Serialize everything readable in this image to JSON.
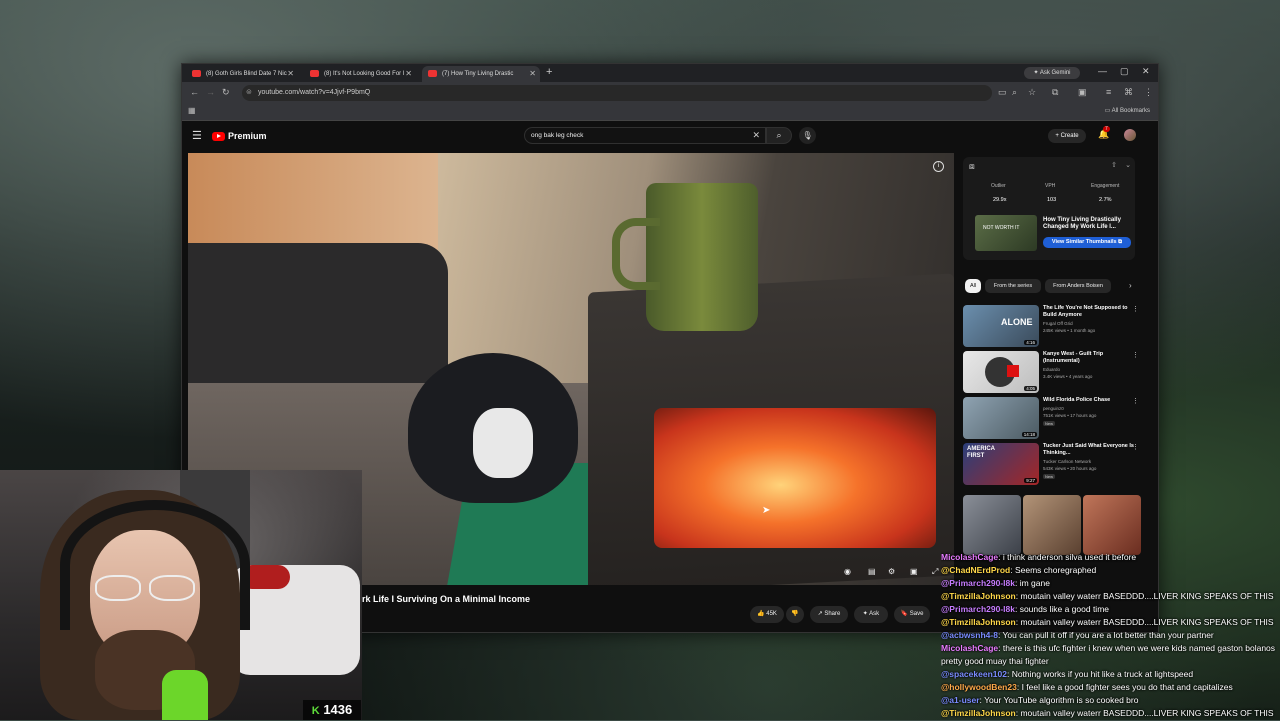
{
  "browser": {
    "tabs": [
      {
        "title": "(8) Goth Girls Blind Date 7 Nic",
        "active": false
      },
      {
        "title": "(8) It's Not Looking Good For I",
        "active": false
      },
      {
        "title": "(7) How Tiny Living Drastic",
        "active": true
      }
    ],
    "gemini_label": "Ask Gemini",
    "url": "youtube.com/watch?v=4Jjvf-P9bmQ",
    "all_bookmarks": "All Bookmarks"
  },
  "youtube": {
    "logo_label": "Premium",
    "search_value": "ong bak leg check",
    "create_label": "Create",
    "notif_count": "7",
    "video_title": "rk Life I Surviving On a Minimal Income",
    "actions": {
      "likes": "45K",
      "share": "Share",
      "ask": "Ask",
      "save": "Save"
    }
  },
  "extension": {
    "stats": [
      {
        "label": "Outlier",
        "value": "29.9x"
      },
      {
        "label": "VPH",
        "value": "103"
      },
      {
        "label": "Engagement",
        "value": "2.7%"
      }
    ],
    "thumb_text": "NOT WORTH IT",
    "video_title": "How Tiny Living Drastically Changed My Work Life I...",
    "button_label": "View Similar Thumbnails"
  },
  "chips": [
    "All",
    "From the series",
    "From Anders Boisen"
  ],
  "recommendations": [
    {
      "title": "The Life You're Not Supposed to Build Anymore",
      "channel": "Frugal Off Grid",
      "meta": "245K views • 1 month ago",
      "duration": "4:16",
      "thumb_text": "ALONE",
      "new": ""
    },
    {
      "title": "Kanye West - Guilt Trip (Instrumental)",
      "channel": "Eduardo",
      "meta": "3.4K views • 4 years ago",
      "duration": "4:05",
      "thumb_text": "",
      "new": ""
    },
    {
      "title": "Wild Florida Police Chase",
      "channel": "penguinz0",
      "meta": "751K views • 17 hours ago",
      "duration": "14:18",
      "thumb_text": "",
      "new": "New"
    },
    {
      "title": "Tucker Just Said What Everyone Is Thinking...",
      "channel": "Tucker Carlson Network",
      "meta": "543K views • 20 hours ago",
      "duration": "9:27",
      "thumb_text": "AMERICA FIRST",
      "new": "New"
    }
  ],
  "stream": {
    "points": "1436"
  },
  "chat": [
    {
      "user": "MicolashCage",
      "color": "#e87cff",
      "text": "i think anderson silva used it before"
    },
    {
      "user": "@ChadNErdProd",
      "color": "#ffd84a",
      "text": "Seems choregraphed"
    },
    {
      "user": "@Primarch290-l8k",
      "color": "#c77dff",
      "text": "im gane"
    },
    {
      "user": "@TimzillaJohnson",
      "color": "#ffd84a",
      "text": "moutain valley waterr BASEDDD....LIVER KING SPEAKS OF THIS"
    },
    {
      "user": "@Primarch290-l8k",
      "color": "#c77dff",
      "text": "sounds like a good time"
    },
    {
      "user": "@TimzillaJohnson",
      "color": "#ffd84a",
      "text": "moutain valley waterr BASEDDD....LIVER KING SPEAKS OF THIS"
    },
    {
      "user": "@acbwsnh4-8",
      "color": "#7a8cff",
      "text": "You can pull it off if you are a lot better than your partner"
    },
    {
      "user": "MicolashCage",
      "color": "#e87cff",
      "text": "there is this ufc fighter i knew when we were kids named gaston bolanos pretty good muay thai fighter"
    },
    {
      "user": "@spacekeen102",
      "color": "#7a8cff",
      "text": "Nothing works if you hit like a truck at lightspeed"
    },
    {
      "user": "@hollywoodBen23",
      "color": "#ffa94a",
      "text": "I feel like a good fighter sees you do that and capitalizes"
    },
    {
      "user": "@a1-user",
      "color": "#7a8cff",
      "text": "Your YouTube algorithm is so cooked bro"
    },
    {
      "user": "@TimzillaJohnson",
      "color": "#ffd84a",
      "text": "moutain valley waterr BASEDDD....LIVER KING SPEAKS OF THIS"
    }
  ]
}
